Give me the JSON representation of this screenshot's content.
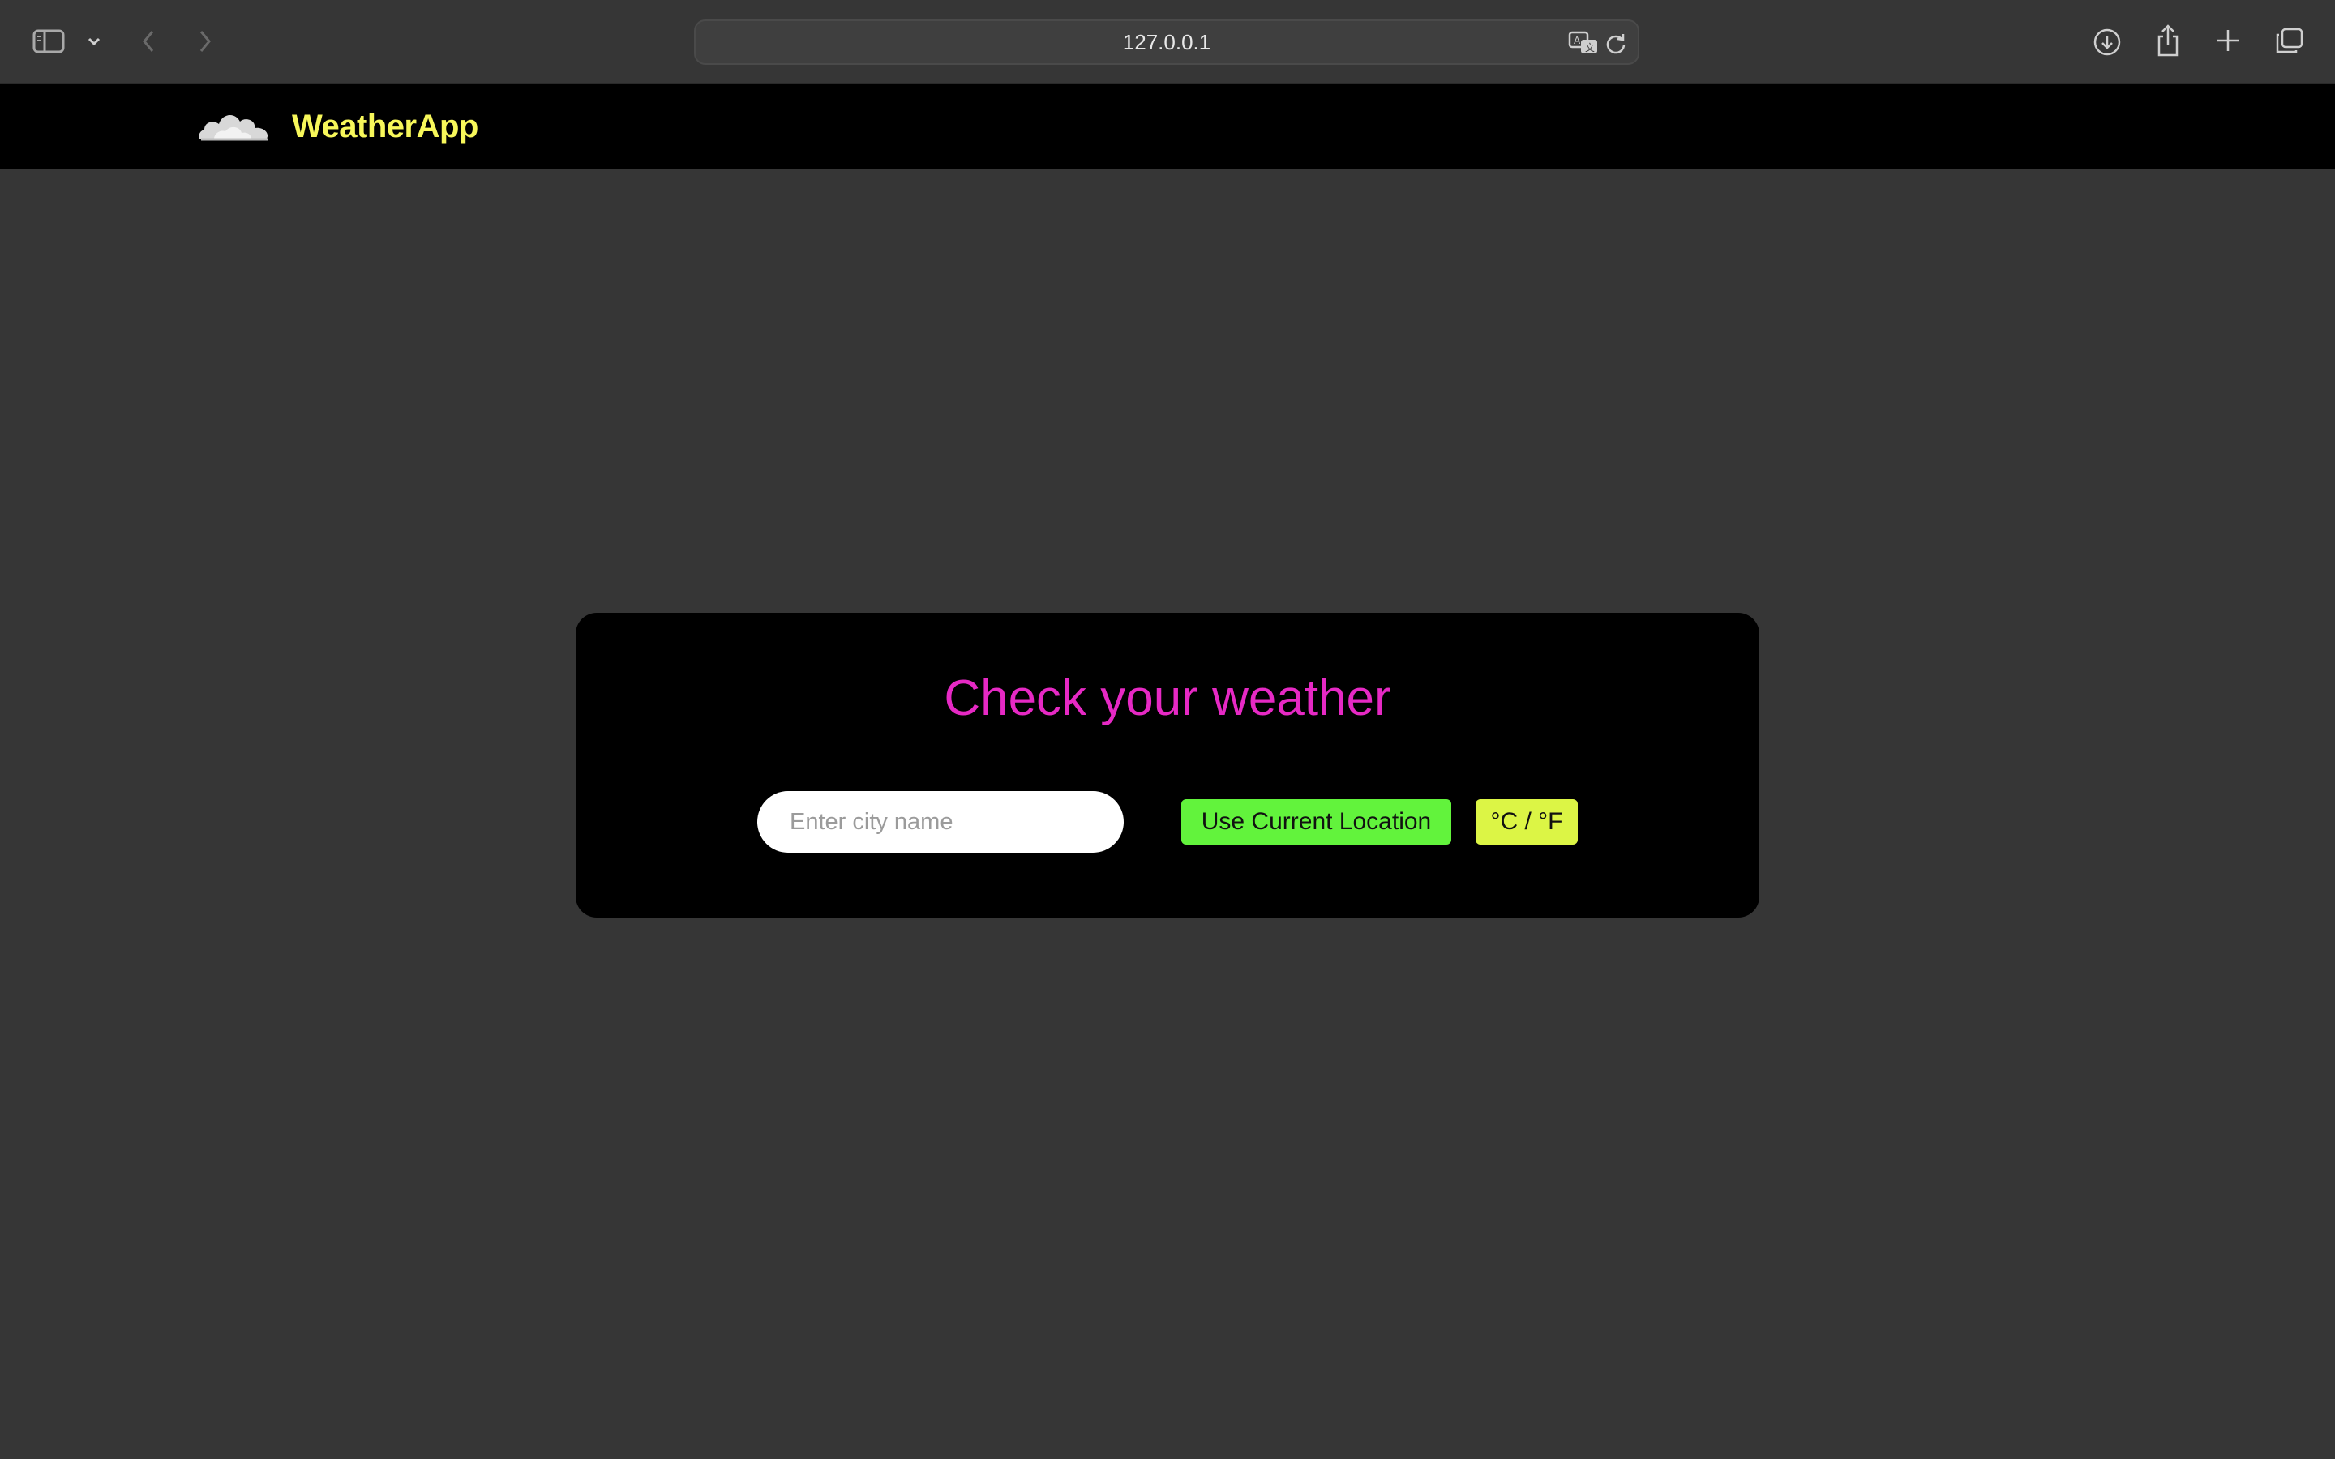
{
  "browser": {
    "url": "127.0.0.1",
    "icons": {
      "sidebar": "sidebar-icon",
      "dropdown": "chevron-down-icon",
      "back": "chevron-left-icon",
      "forward": "chevron-right-icon",
      "translate": "translate-icon",
      "reload": "reload-icon",
      "download": "download-icon",
      "share": "share-icon",
      "new_tab": "plus-icon",
      "tabs": "tab-overview-icon"
    }
  },
  "header": {
    "brand": "WeatherApp",
    "logo": "cloud-icon",
    "brand_color": "#f7f75a"
  },
  "card": {
    "title": "Check your weather",
    "title_color": "#e629c4",
    "city_placeholder": "Enter city name",
    "city_value": "",
    "location_button": "Use Current Location",
    "location_button_color": "#62f33c",
    "unit_button": "°C / °F",
    "unit_button_color": "#dcf545"
  }
}
